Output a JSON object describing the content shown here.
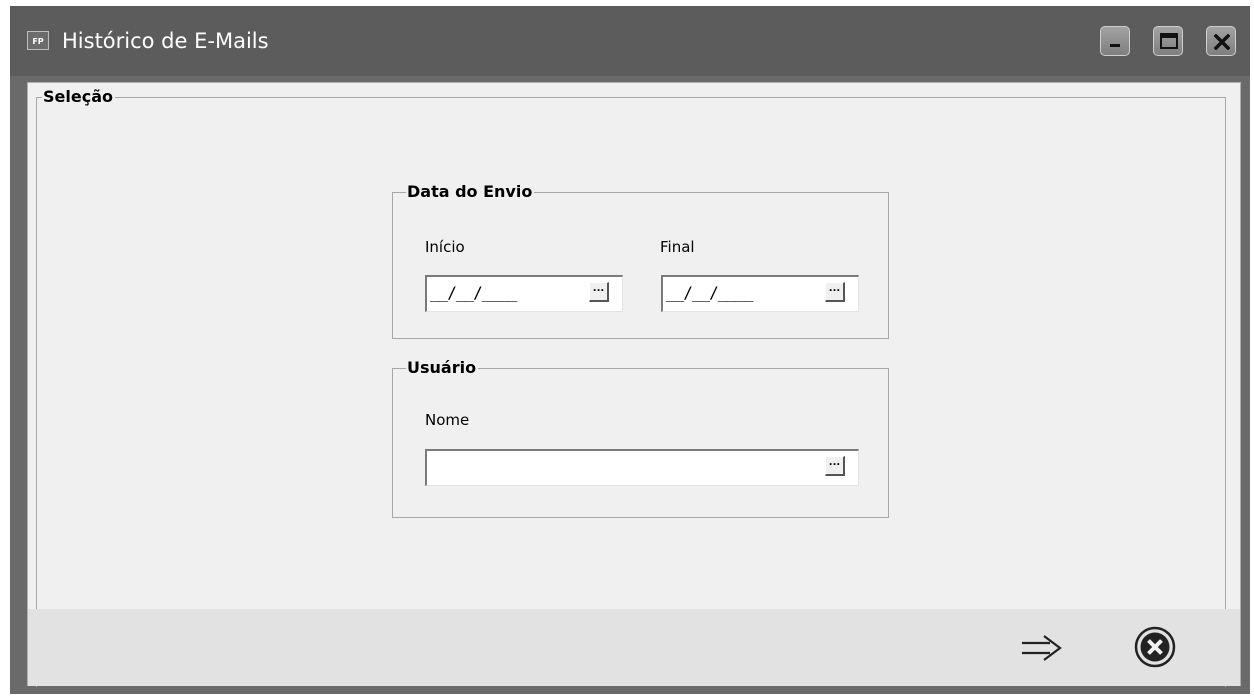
{
  "window": {
    "title": "Histórico de E-Mails",
    "app_icon_text": "FP",
    "controls": [
      "minimize-icon",
      "maximize-icon",
      "close-icon"
    ]
  },
  "selection": {
    "title": "Seleção",
    "send_date": {
      "title": "Data do Envio",
      "start_label": "Início",
      "start_value": "__/__/____",
      "end_label": "Final",
      "end_value": "__/__/____"
    },
    "user": {
      "title": "Usuário",
      "name_label": "Nome",
      "name_value": ""
    },
    "lookup_button_label": "..."
  },
  "footer": {
    "buttons": [
      {
        "icon": "arrow-right-icon",
        "action": "confirm"
      },
      {
        "icon": "cancel-circle-icon",
        "action": "cancel"
      }
    ]
  }
}
